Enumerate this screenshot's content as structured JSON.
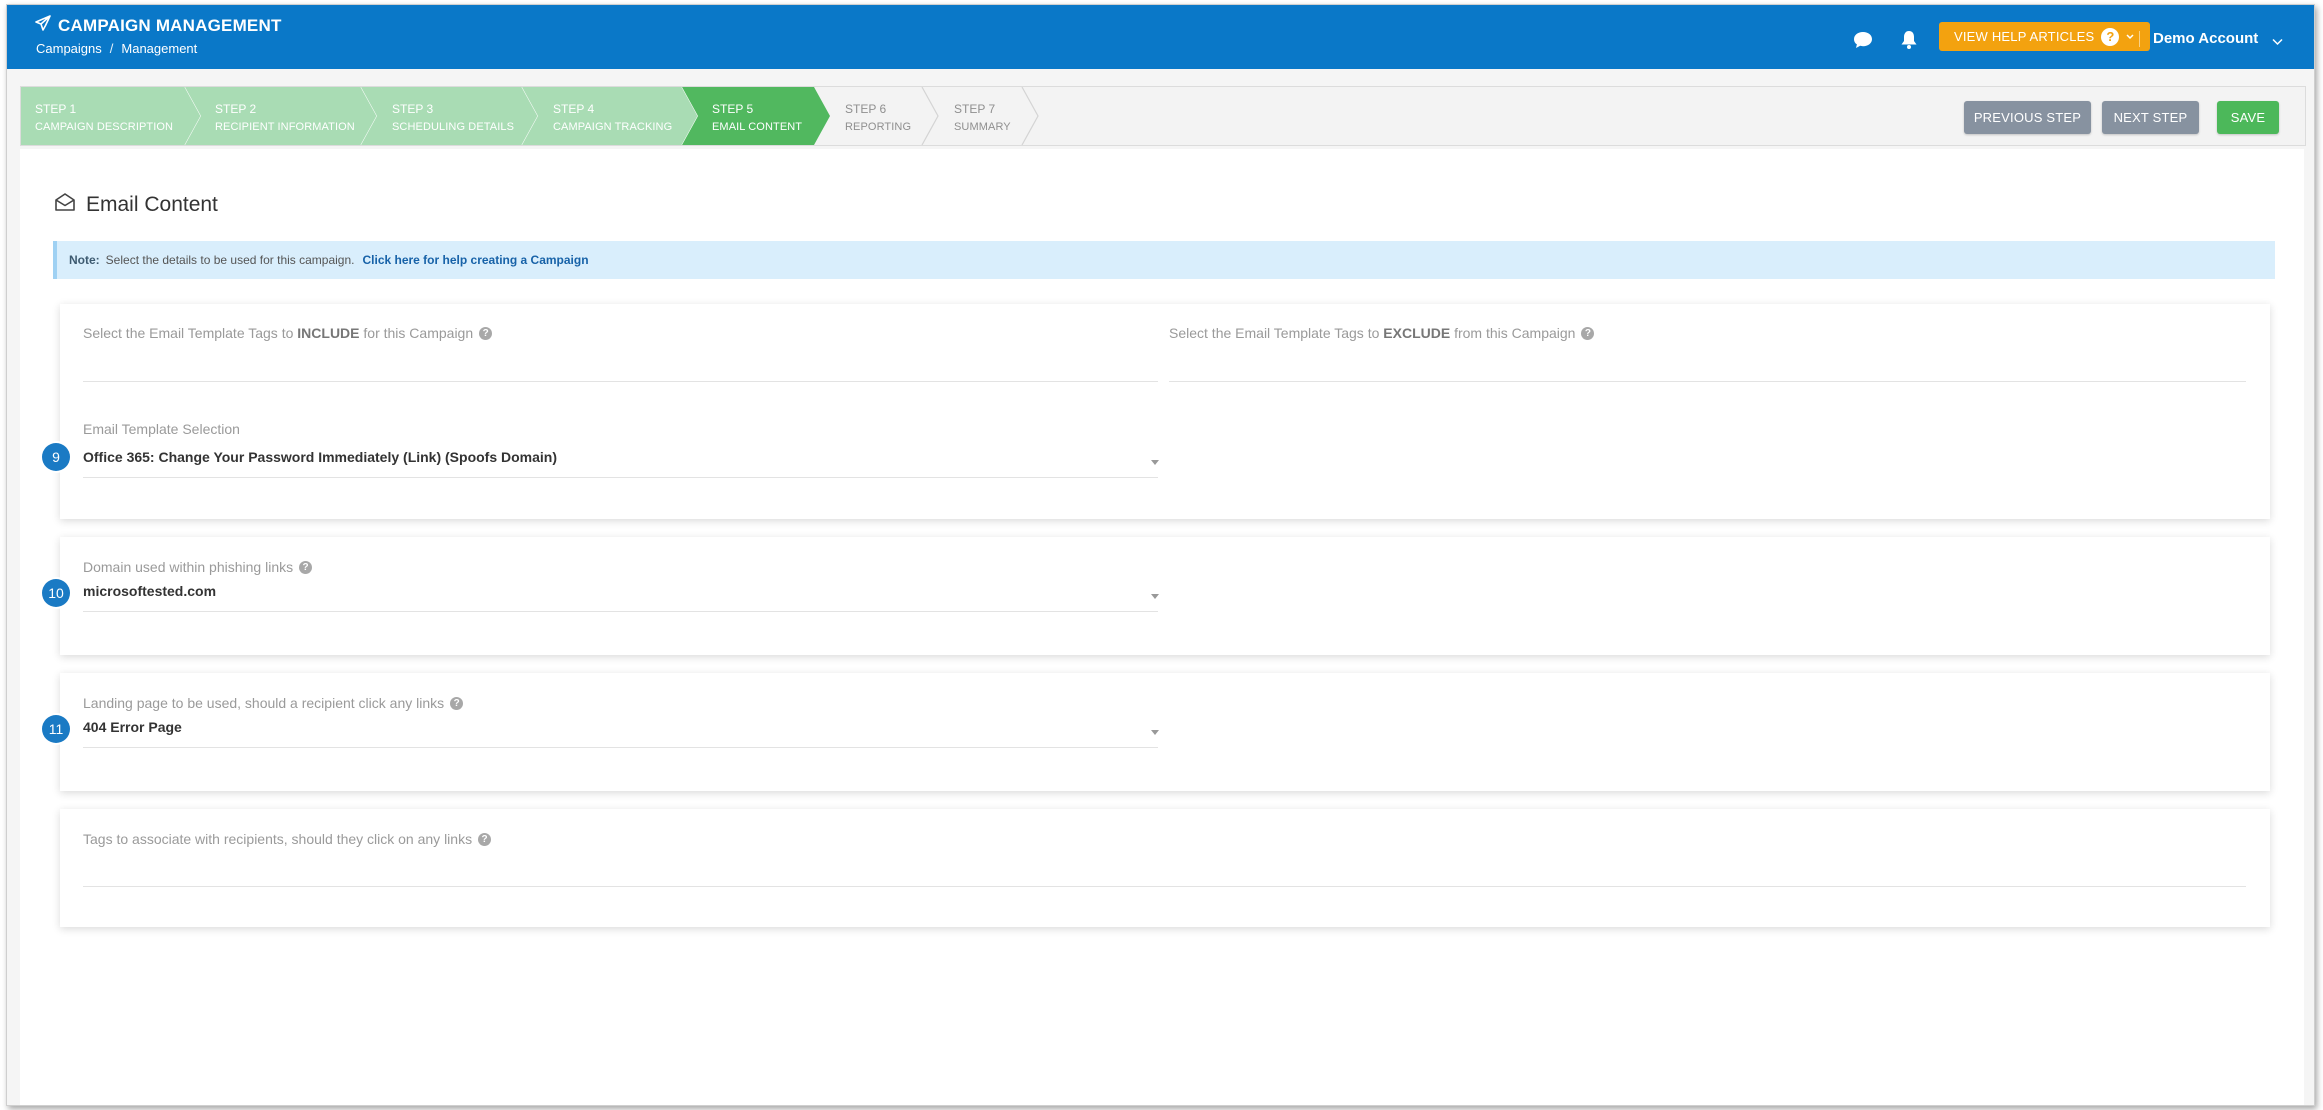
{
  "header": {
    "app_title": "CAMPAIGN MANAGEMENT",
    "breadcrumb": [
      "Campaigns",
      "/",
      "Management"
    ],
    "help_button": "VIEW HELP ARTICLES",
    "help_icon_text": "?",
    "account_name": "Demo Account",
    "header_bg": "#0a78c8",
    "help_bg": "#f3a20f"
  },
  "steps": [
    {
      "num": "STEP 1",
      "label": "CAMPAIGN DESCRIPTION",
      "state": "done"
    },
    {
      "num": "STEP 2",
      "label": "RECIPIENT INFORMATION",
      "state": "done"
    },
    {
      "num": "STEP 3",
      "label": "SCHEDULING DETAILS",
      "state": "done"
    },
    {
      "num": "STEP 4",
      "label": "CAMPAIGN TRACKING",
      "state": "done"
    },
    {
      "num": "STEP 5",
      "label": "EMAIL CONTENT",
      "state": "active"
    },
    {
      "num": "STEP 6",
      "label": "REPORTING",
      "state": "todo"
    },
    {
      "num": "STEP 7",
      "label": "SUMMARY",
      "state": "todo"
    }
  ],
  "actions": {
    "previous": "PREVIOUS STEP",
    "next": "NEXT STEP",
    "save": "SAVE"
  },
  "page": {
    "title": "Email Content",
    "note_label": "Note:",
    "note_text": "Select the details to be used for this campaign.",
    "note_link": "Click here for help creating a Campaign"
  },
  "form": {
    "include_pre": "Select the Email Template Tags to",
    "include_bold": "INCLUDE",
    "include_post": "for this Campaign",
    "exclude_pre": "Select the Email Template Tags to",
    "exclude_bold": "EXCLUDE",
    "exclude_post": "from this Campaign",
    "template_label": "Email Template Selection",
    "template_value": "Office 365: Change Your Password Immediately (Link) (Spoofs Domain)",
    "template_badge": "9",
    "domain_label": "Domain used within phishing links",
    "domain_value": "microsoftested.com",
    "domain_badge": "10",
    "landing_label": "Landing page to be used, should a recipient click any links",
    "landing_value": "404 Error Page",
    "landing_badge": "11",
    "tags_label": "Tags to associate with recipients, should they click on any links"
  },
  "icons": {
    "title_icon": "paper-plane-icon",
    "chat": "chat-bubble-icon",
    "bell": "bell-icon",
    "page": "open-envelope-icon"
  },
  "colors": {
    "step_done": "#a9dcb4",
    "step_active": "#51b85f",
    "badge": "#1a7ac4",
    "save": "#4cb85a",
    "nav_button": "#8792a0"
  }
}
